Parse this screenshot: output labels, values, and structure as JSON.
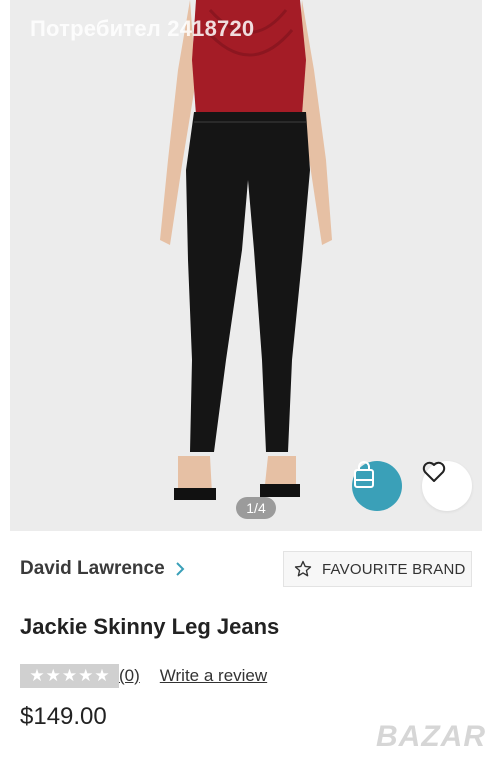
{
  "watermark": "Потребител 2418720",
  "gallery": {
    "counter": "1/4"
  },
  "bag_icon": "shopping-bag-icon",
  "wishlist_icon": "heart-icon",
  "brand": {
    "name": "David Lawrence",
    "favourite_label": "FAVOURITE BRAND"
  },
  "product": {
    "title": "Jackie Skinny Leg Jeans",
    "review_count": "(0)",
    "write_review": "Write a review",
    "price": "$149.00",
    "rating": 0
  },
  "site_logo": "BAZAR",
  "colors": {
    "accent": "#3aa0b8",
    "top": "#a41c26",
    "jeans": "#151515"
  }
}
